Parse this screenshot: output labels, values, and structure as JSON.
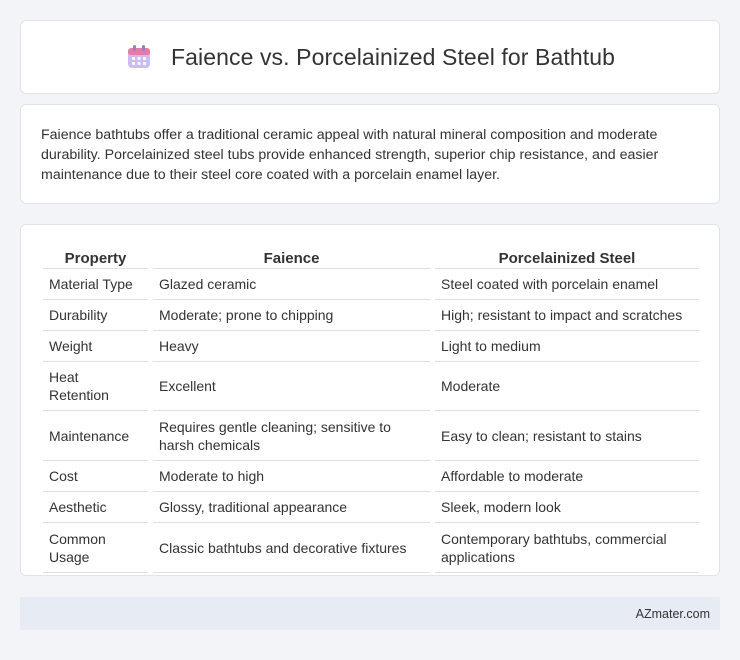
{
  "header": {
    "title": "Faience vs. Porcelainized Steel for Bathtub",
    "icon": "calendar-icon"
  },
  "summary": {
    "text": "Faience bathtubs offer a traditional ceramic appeal with natural mineral composition and moderate durability. Porcelainized steel tubs provide enhanced strength, superior chip resistance, and easier maintenance due to their steel core coated with a porcelain enamel layer."
  },
  "table": {
    "headers": [
      "Property",
      "Faience",
      "Porcelainized Steel"
    ],
    "rows": [
      [
        "Material Type",
        "Glazed ceramic",
        "Steel coated with porcelain enamel"
      ],
      [
        "Durability",
        "Moderate; prone to chipping",
        "High; resistant to impact and scratches"
      ],
      [
        "Weight",
        "Heavy",
        "Light to medium"
      ],
      [
        "Heat Retention",
        "Excellent",
        "Moderate"
      ],
      [
        "Maintenance",
        "Requires gentle cleaning; sensitive to harsh chemicals",
        "Easy to clean; resistant to stains"
      ],
      [
        "Cost",
        "Moderate to high",
        "Affordable to moderate"
      ],
      [
        "Aesthetic",
        "Glossy, traditional appearance",
        "Sleek, modern look"
      ],
      [
        "Common Usage",
        "Classic bathtubs and decorative fixtures",
        "Contemporary bathtubs, commercial applications"
      ]
    ]
  },
  "footer": {
    "brand": "AZmater.com"
  },
  "colors": {
    "background": "#f3f4f8",
    "card": "#ffffff",
    "footer": "#e7ebf3",
    "icon_top": "#e96f9a",
    "icon_body": "#c8b8f0"
  }
}
